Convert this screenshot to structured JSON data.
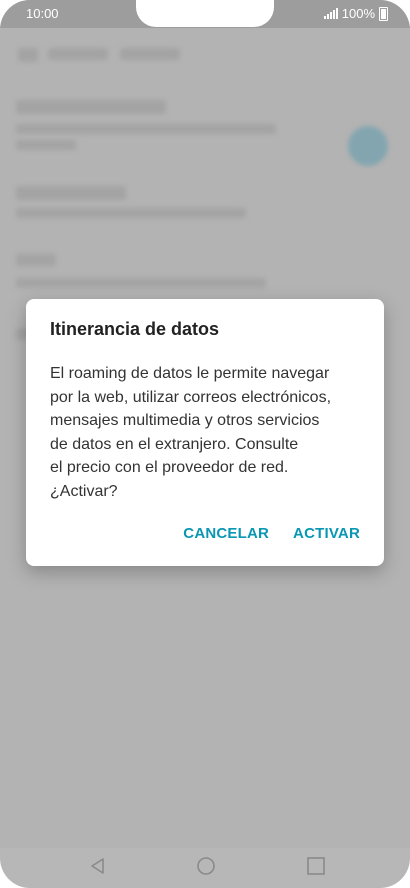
{
  "status_bar": {
    "time": "10:00",
    "battery": "100%",
    "icons": [
      "signal-icon",
      "battery-icon"
    ]
  },
  "dialog": {
    "title": "Itinerancia de datos",
    "body": "El roaming de datos le permite navegar\npor la web, utilizar correos electrónicos,\nmensajes multimedia y otros servicios\nde datos en el extranjero. Consulte\nel precio con el proveedor de red.\n¿Activar?",
    "cancel_label": "CANCELAR",
    "activate_label": "ACTIVAR"
  },
  "nav_bar": {
    "icons": [
      "back-icon",
      "home-icon",
      "recent-apps-icon"
    ]
  },
  "colors": {
    "accent": "#0a97b3",
    "overlay": "#b7b7b7",
    "dialog_bg": "#ffffff"
  }
}
